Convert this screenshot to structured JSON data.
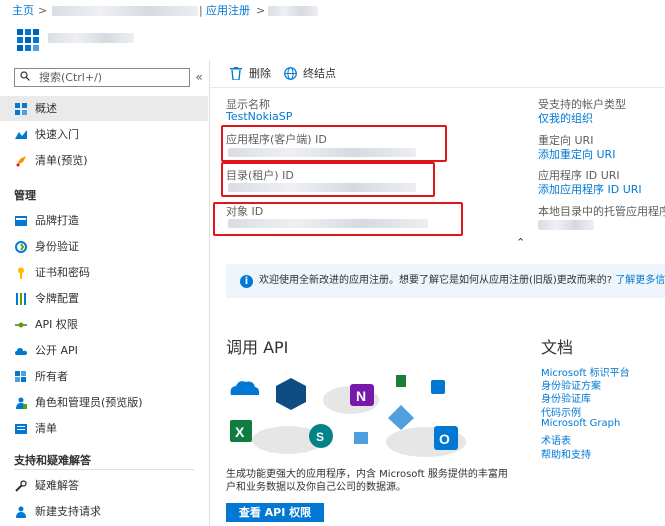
{
  "breadcrumb": {
    "home": "主页",
    "sep": ">",
    "app_registrations": "应用注册"
  },
  "colors": {
    "accent": "#0078d4",
    "highlight": "#e0161b",
    "info_bg": "#eef5fc"
  },
  "sidebar": {
    "search_placeholder": "搜索(Ctrl+/)",
    "collapse": "«",
    "items": [
      {
        "label": "概述",
        "icon": "overview-icon"
      },
      {
        "label": "快速入门",
        "icon": "quickstart-icon"
      },
      {
        "label": "清单(预览)",
        "icon": "rocket-icon"
      }
    ],
    "manage_header": "管理",
    "manage_items": [
      {
        "label": "品牌打造",
        "icon": "branding-icon"
      },
      {
        "label": "身份验证",
        "icon": "authentication-icon"
      },
      {
        "label": "证书和密码",
        "icon": "key-icon"
      },
      {
        "label": "令牌配置",
        "icon": "token-config-icon"
      },
      {
        "label": "API 权限",
        "icon": "api-permissions-icon"
      },
      {
        "label": "公开 API",
        "icon": "cloud-icon"
      },
      {
        "label": "所有者",
        "icon": "owners-icon"
      },
      {
        "label": "角色和管理员(预览版)",
        "icon": "roles-icon"
      },
      {
        "label": "清单",
        "icon": "manifest-icon"
      }
    ],
    "support_header": "支持和疑难解答",
    "support_items": [
      {
        "label": "疑难解答",
        "icon": "wrench-icon"
      },
      {
        "label": "新建支持请求",
        "icon": "support-person-icon"
      }
    ]
  },
  "toolbar": {
    "delete": "删除",
    "endpoints": "终结点"
  },
  "essentials": {
    "display_name_label": "显示名称",
    "display_name_value": "TestNokiaSP",
    "client_id_label": "应用程序(客户端) ID",
    "tenant_id_label": "目录(租户) ID",
    "object_id_label": "对象 ID",
    "account_types_label": "受支持的帐户类型",
    "account_types_value": "仅我的组织",
    "redirect_label": "重定向 URI",
    "redirect_value": "添加重定向 URI",
    "app_id_uri_label": "应用程序 ID URI",
    "app_id_uri_value": "添加应用程序 ID URI",
    "managed_app_label": "本地目录中的托管应用程序",
    "collapse": "⌃"
  },
  "info_bar": {
    "text": "欢迎使用全新改进的应用注册。想要了解它是如何从应用注册(旧版)更改而来的?",
    "link": "了解更多信息"
  },
  "api": {
    "heading": "调用 API",
    "description": "生成功能更强大的应用程序，内含 Microsoft 服务提供的丰富用户和业务数据以及你自己公司的数据源。",
    "button": "查看 API 权限"
  },
  "docs": {
    "heading": "文档",
    "links": [
      "Microsoft 标识平台",
      "身份验证方案",
      "身份验证库",
      "代码示例",
      "Microsoft Graph",
      "术语表",
      "帮助和支持"
    ]
  }
}
